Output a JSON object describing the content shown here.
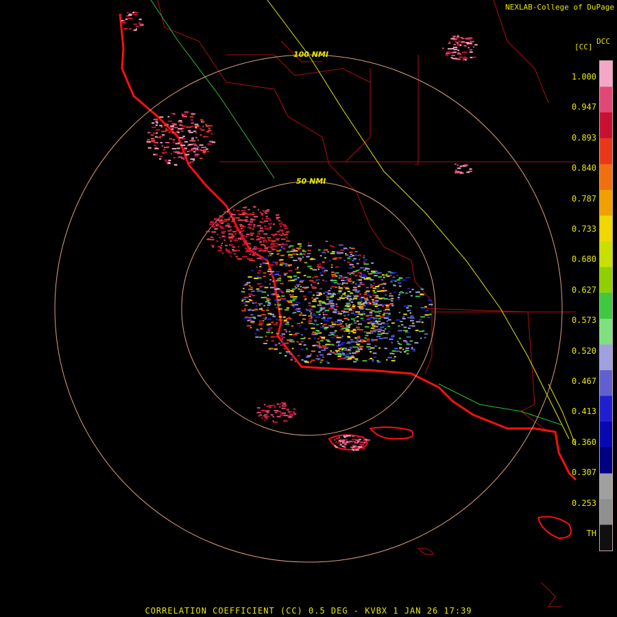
{
  "header": {
    "credit": "NEXLAB-College of DuPage",
    "product_code": "DCC",
    "unit": "[CC]"
  },
  "colorbar": {
    "labels": [
      "1.000",
      "0.947",
      "0.893",
      "0.840",
      "0.787",
      "0.733",
      "0.680",
      "0.627",
      "0.573",
      "0.520",
      "0.467",
      "0.413",
      "0.360",
      "0.307",
      "0.253",
      "TH"
    ],
    "colors": [
      "#f4a8c8",
      "#e04878",
      "#c81030",
      "#e83818",
      "#f07010",
      "#f0a000",
      "#f0d800",
      "#c8e000",
      "#90d000",
      "#40c840",
      "#80e080",
      "#a0a0e0",
      "#6060d0",
      "#2020d0",
      "#0808b0",
      "#000080",
      "#a0a0a0",
      "#909090",
      "#101010"
    ]
  },
  "rings": [
    {
      "label": "100 NMI"
    },
    {
      "label": "50 NMI"
    }
  ],
  "footer": "CORRELATION COEFFICIENT (CC) 0.5 DEG - KVBX 1 JAN 26 17:39"
}
